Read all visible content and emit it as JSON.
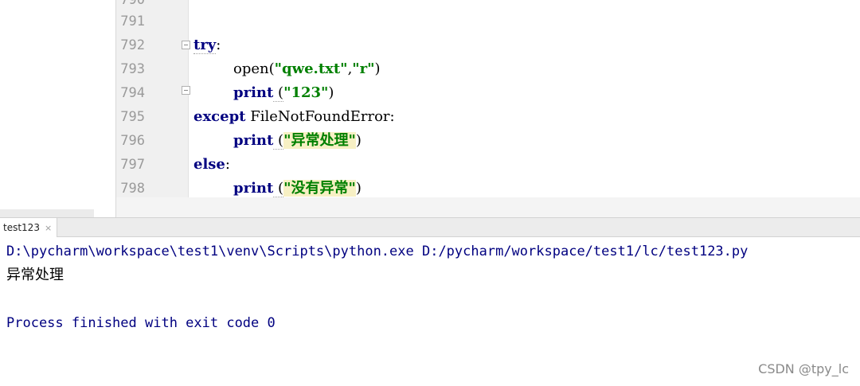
{
  "editor": {
    "top_partial_line_number": "790",
    "line_numbers": [
      "791",
      "792",
      "793",
      "794",
      "795",
      "796",
      "797",
      "798"
    ],
    "code": {
      "l792": {
        "kw": "try",
        "punct": ":"
      },
      "l793": {
        "fn": "open(",
        "s1": "\"qwe.txt\"",
        "comma": ",",
        "s2": "\"r\"",
        "close": ")"
      },
      "l794": {
        "kw": "print",
        "open": " (",
        "s": "\"123\"",
        "close": ")"
      },
      "l795": {
        "kw": "except",
        "exc": " FileNotFoundError:"
      },
      "l796": {
        "kw": "print",
        "open": " (",
        "s": "\"异常处理\"",
        "close": ")"
      },
      "l797": {
        "kw": "else",
        "punct": ":"
      },
      "l798": {
        "kw": "print",
        "open": " (",
        "s": "\"没有异常\"",
        "close": ")"
      }
    }
  },
  "run_tab": {
    "label": "test123",
    "close_glyph": "×"
  },
  "console": {
    "command": "D:\\pycharm\\workspace\\test1\\venv\\Scripts\\python.exe D:/pycharm/workspace/test1/lc/test123.py",
    "output": "异常处理",
    "finished": "Process finished with exit code 0"
  },
  "watermark": "CSDN @tpy_lc"
}
